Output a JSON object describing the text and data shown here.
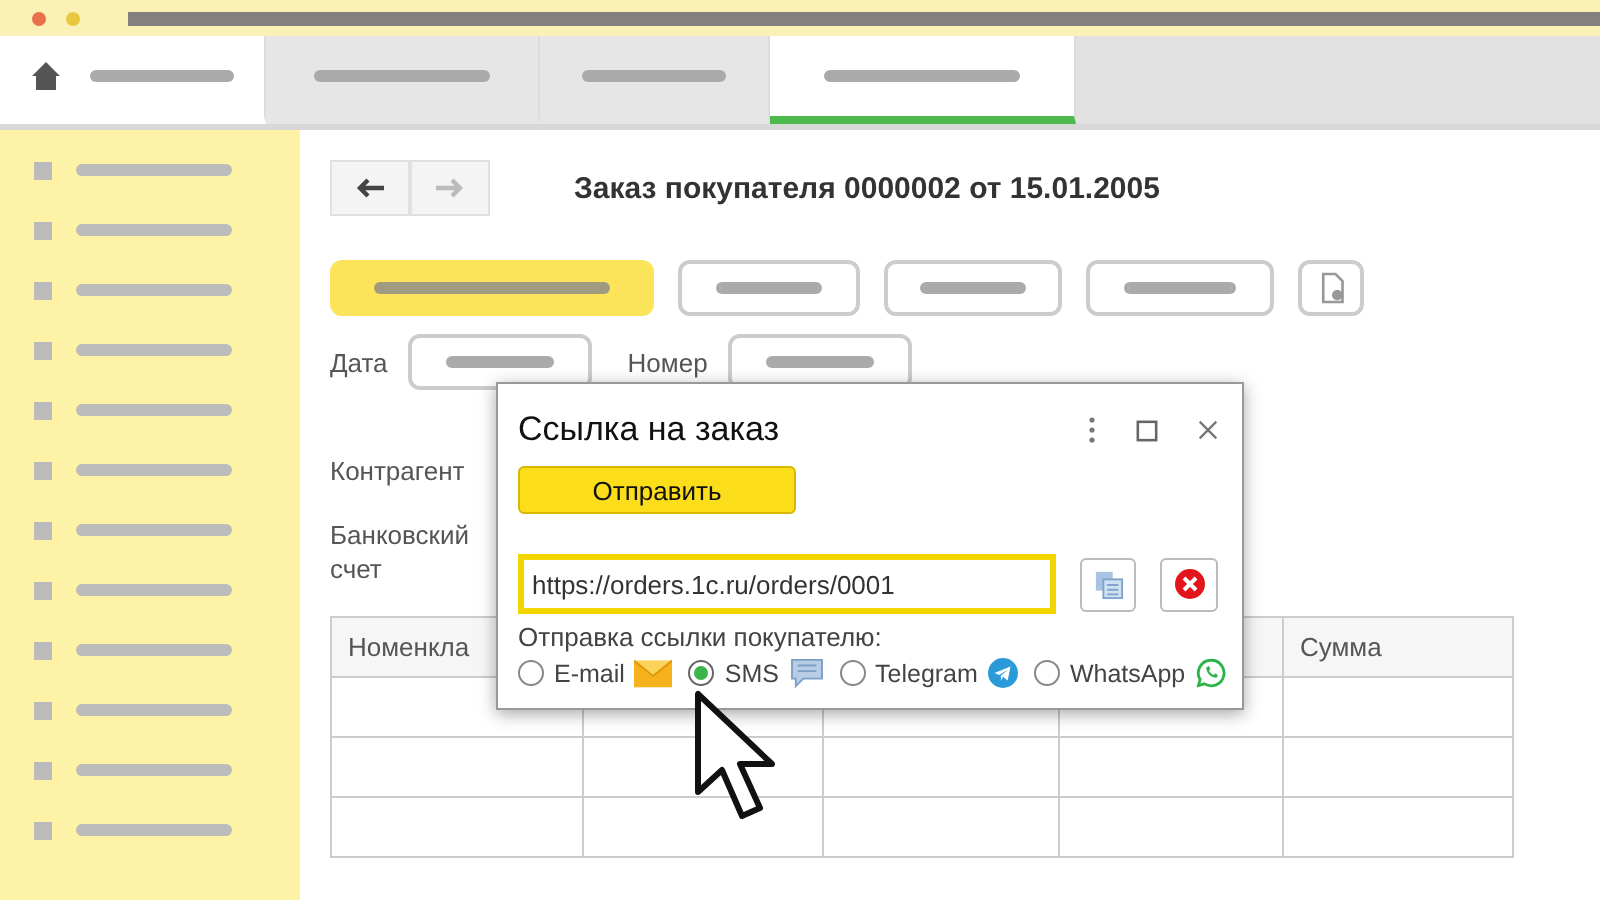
{
  "tabs": [
    {
      "kind": "home",
      "selected": false
    },
    {
      "kind": "page",
      "selected": false
    },
    {
      "kind": "page",
      "selected": false
    },
    {
      "kind": "page",
      "selected": true
    }
  ],
  "document": {
    "title": "Заказ покупателя 0000002 от 15.01.2005",
    "date_label": "Дата",
    "number_label": "Номер",
    "counterparty_label": "Контрагент",
    "bank_account_label": "Банковский счет",
    "table": {
      "columns": [
        "Номенкла",
        "Сумма"
      ]
    }
  },
  "dialog": {
    "title": "Ссылка на заказ",
    "send_button": "Отправить",
    "link_field": {
      "value": "https://orders.1c.ru/orders/0001"
    },
    "send_label": "Отправка ссылки покупателю:",
    "channels": [
      {
        "label": "E-mail",
        "selected": false
      },
      {
        "label": "SMS",
        "selected": true
      },
      {
        "label": "Telegram",
        "selected": false
      },
      {
        "label": "WhatsApp",
        "selected": false
      }
    ]
  }
}
